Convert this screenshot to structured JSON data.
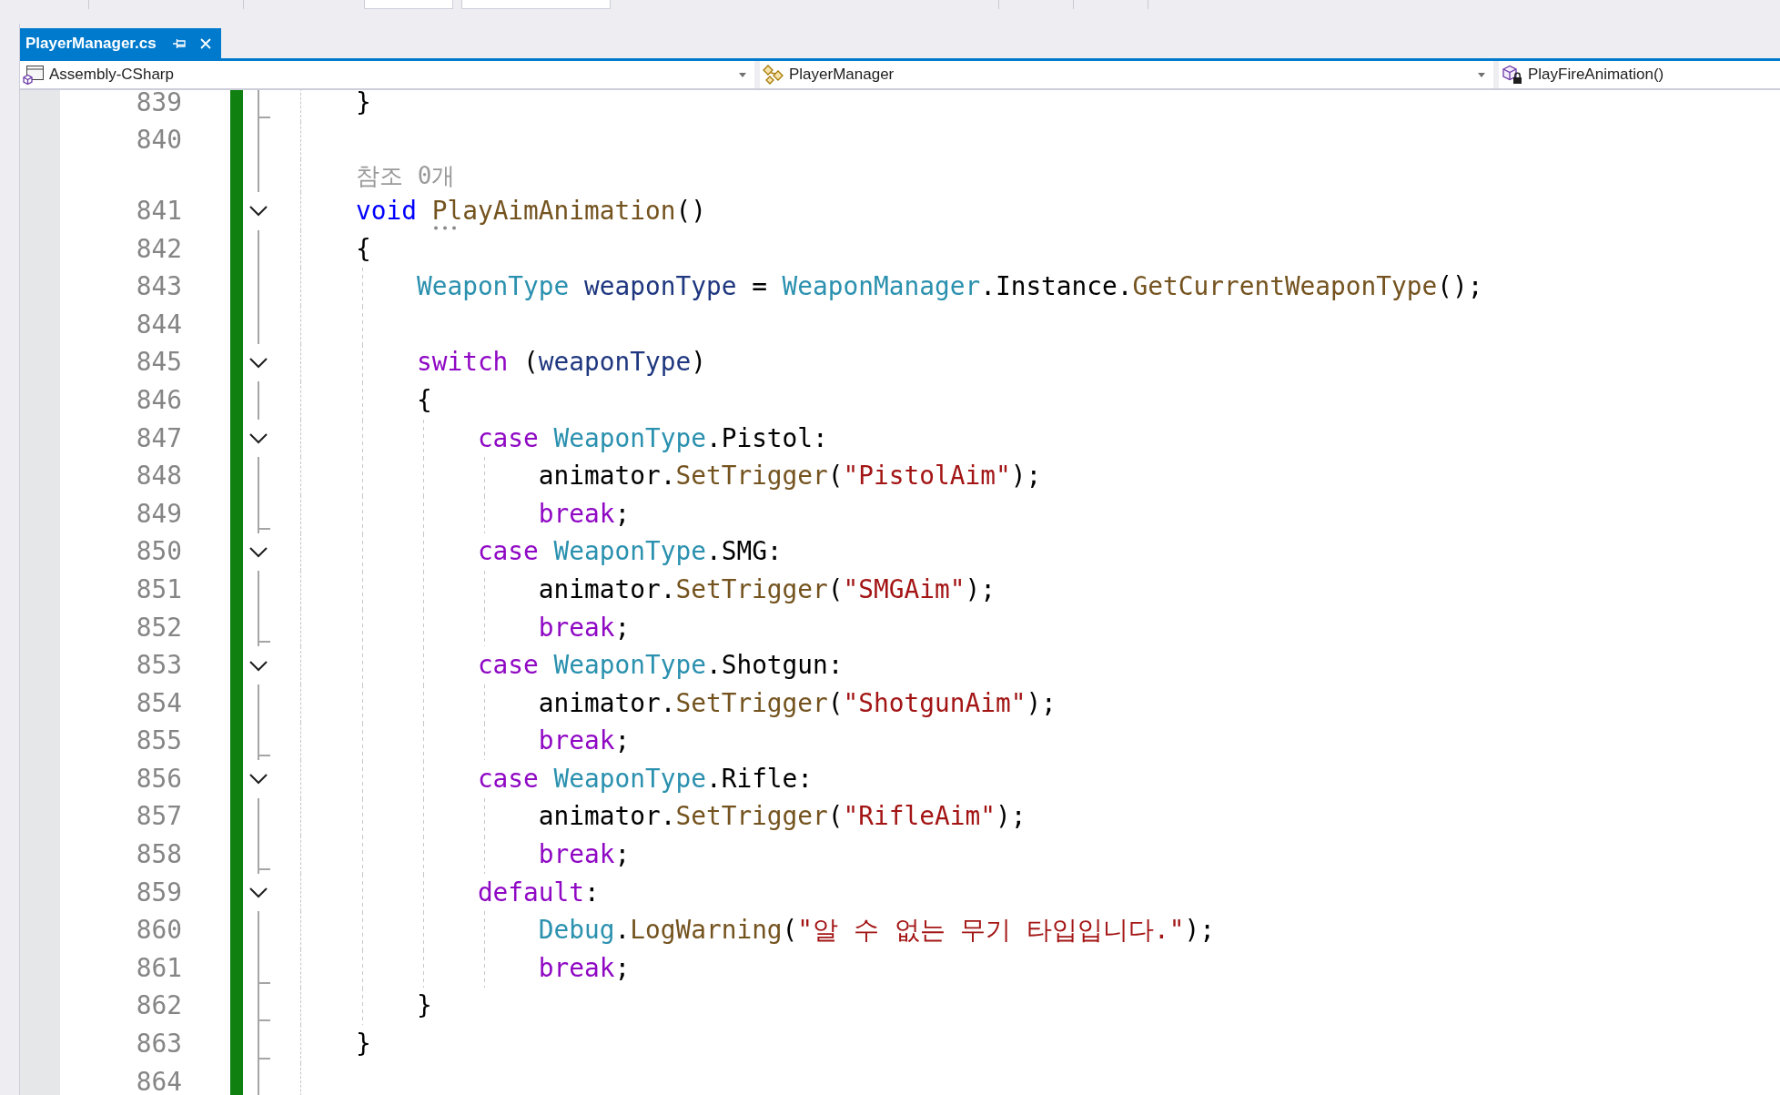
{
  "tabs": [
    {
      "label": "PlayerManager.cs",
      "selected": true,
      "pinned": false
    }
  ],
  "navigation_bar": [
    {
      "kind": "project",
      "text": "Assembly-CSharp",
      "caret": true
    },
    {
      "kind": "class",
      "text": "PlayerManager",
      "caret": true
    },
    {
      "kind": "method",
      "text": "PlayFireAnimation()",
      "caret": false
    }
  ],
  "editor": {
    "lines": [
      {
        "number": "839",
        "collapsible": false,
        "block_end": true,
        "changed": true,
        "tokens": [
          {
            "kind": "plain",
            "text": "}"
          }
        ]
      },
      {
        "number": "840",
        "collapsible": false,
        "block_end": false,
        "changed": true
      },
      {
        "number": "841",
        "codelens": "참조 0개",
        "collapsible": true,
        "block_end": false,
        "changed": true,
        "tokens": [
          {
            "kind": "keyword",
            "text": "void"
          },
          {
            "kind": "method",
            "text": " PlayAimAnimation",
            "suggestion": true
          },
          {
            "kind": "plain",
            "text": "()"
          }
        ]
      },
      {
        "number": "842",
        "collapsible": false,
        "block_end": false,
        "changed": true,
        "tokens": [
          {
            "kind": "plain",
            "text": "{"
          }
        ],
        "children": [
          {
            "number": "843",
            "collapsible": false,
            "block_end": false,
            "changed": true,
            "tokens": [
              {
                "kind": "type",
                "text": "WeaponType"
              },
              {
                "kind": "variable",
                "text": " weaponType"
              },
              {
                "kind": "plain",
                "text": " = "
              },
              {
                "kind": "type",
                "text": "WeaponManager"
              },
              {
                "kind": "plain",
                "text": ".Instance."
              },
              {
                "kind": "method",
                "text": "GetCurrentWeaponType"
              },
              {
                "kind": "plain",
                "text": "();"
              }
            ]
          },
          {
            "number": "844",
            "collapsible": false,
            "block_end": false,
            "changed": true
          },
          {
            "number": "845",
            "collapsible": true,
            "block_end": false,
            "changed": true,
            "tokens": [
              {
                "kind": "control",
                "text": "switch"
              },
              {
                "kind": "plain",
                "text": " ("
              },
              {
                "kind": "variable",
                "text": "weaponType"
              },
              {
                "kind": "plain",
                "text": ")"
              }
            ]
          },
          {
            "number": "846",
            "collapsible": false,
            "block_end": false,
            "changed": true,
            "tokens": [
              {
                "kind": "plain",
                "text": "{"
              }
            ],
            "children": [
              {
                "number": "847",
                "collapsible": true,
                "block_end": false,
                "changed": true,
                "tokens": [
                  {
                    "kind": "control",
                    "text": "case"
                  },
                  {
                    "kind": "type",
                    "text": " WeaponType"
                  },
                  {
                    "kind": "plain",
                    "text": ".Pistol:"
                  }
                ],
                "children": [
                  {
                    "number": "848",
                    "collapsible": false,
                    "block_end": false,
                    "changed": true,
                    "tokens": [
                      {
                        "kind": "plain",
                        "text": "animator."
                      },
                      {
                        "kind": "method",
                        "text": "SetTrigger"
                      },
                      {
                        "kind": "plain",
                        "text": "("
                      },
                      {
                        "kind": "string",
                        "text": "\"PistolAim\""
                      },
                      {
                        "kind": "plain",
                        "text": ");"
                      }
                    ]
                  },
                  {
                    "number": "849",
                    "collapsible": false,
                    "block_end": true,
                    "changed": true,
                    "tokens": [
                      {
                        "kind": "control",
                        "text": "break"
                      },
                      {
                        "kind": "plain",
                        "text": ";"
                      }
                    ]
                  }
                ]
              },
              {
                "number": "850",
                "collapsible": true,
                "block_end": false,
                "changed": true,
                "tokens": [
                  {
                    "kind": "control",
                    "text": "case"
                  },
                  {
                    "kind": "type",
                    "text": " WeaponType"
                  },
                  {
                    "kind": "plain",
                    "text": ".SMG:"
                  }
                ],
                "children": [
                  {
                    "number": "851",
                    "collapsible": false,
                    "block_end": false,
                    "changed": true,
                    "tokens": [
                      {
                        "kind": "plain",
                        "text": "animator."
                      },
                      {
                        "kind": "method",
                        "text": "SetTrigger"
                      },
                      {
                        "kind": "plain",
                        "text": "("
                      },
                      {
                        "kind": "string",
                        "text": "\"SMGAim\""
                      },
                      {
                        "kind": "plain",
                        "text": ");"
                      }
                    ]
                  },
                  {
                    "number": "852",
                    "collapsible": false,
                    "block_end": true,
                    "changed": true,
                    "tokens": [
                      {
                        "kind": "control",
                        "text": "break"
                      },
                      {
                        "kind": "plain",
                        "text": ";"
                      }
                    ]
                  }
                ]
              },
              {
                "number": "853",
                "collapsible": true,
                "block_end": false,
                "changed": true,
                "tokens": [
                  {
                    "kind": "control",
                    "text": "case"
                  },
                  {
                    "kind": "type",
                    "text": " WeaponType"
                  },
                  {
                    "kind": "plain",
                    "text": ".Shotgun:"
                  }
                ],
                "children": [
                  {
                    "number": "854",
                    "collapsible": false,
                    "block_end": false,
                    "changed": true,
                    "tokens": [
                      {
                        "kind": "plain",
                        "text": "animator."
                      },
                      {
                        "kind": "method",
                        "text": "SetTrigger"
                      },
                      {
                        "kind": "plain",
                        "text": "("
                      },
                      {
                        "kind": "string",
                        "text": "\"ShotgunAim\""
                      },
                      {
                        "kind": "plain",
                        "text": ");"
                      }
                    ]
                  },
                  {
                    "number": "855",
                    "collapsible": false,
                    "block_end": true,
                    "changed": true,
                    "tokens": [
                      {
                        "kind": "control",
                        "text": "break"
                      },
                      {
                        "kind": "plain",
                        "text": ";"
                      }
                    ]
                  }
                ]
              },
              {
                "number": "856",
                "collapsible": true,
                "block_end": false,
                "changed": true,
                "tokens": [
                  {
                    "kind": "control",
                    "text": "case"
                  },
                  {
                    "kind": "type",
                    "text": " WeaponType"
                  },
                  {
                    "kind": "plain",
                    "text": ".Rifle:"
                  }
                ],
                "children": [
                  {
                    "number": "857",
                    "collapsible": false,
                    "block_end": false,
                    "changed": true,
                    "tokens": [
                      {
                        "kind": "plain",
                        "text": "animator."
                      },
                      {
                        "kind": "method",
                        "text": "SetTrigger"
                      },
                      {
                        "kind": "plain",
                        "text": "("
                      },
                      {
                        "kind": "string",
                        "text": "\"RifleAim\""
                      },
                      {
                        "kind": "plain",
                        "text": ");"
                      }
                    ]
                  },
                  {
                    "number": "858",
                    "collapsible": false,
                    "block_end": true,
                    "changed": true,
                    "tokens": [
                      {
                        "kind": "control",
                        "text": "break"
                      },
                      {
                        "kind": "plain",
                        "text": ";"
                      }
                    ]
                  }
                ]
              },
              {
                "number": "859",
                "collapsible": true,
                "block_end": false,
                "changed": true,
                "tokens": [
                  {
                    "kind": "control",
                    "text": "default"
                  },
                  {
                    "kind": "plain",
                    "text": ":"
                  }
                ],
                "children": [
                  {
                    "number": "860",
                    "collapsible": false,
                    "block_end": false,
                    "changed": true,
                    "tokens": [
                      {
                        "kind": "type",
                        "text": "Debug"
                      },
                      {
                        "kind": "plain",
                        "text": "."
                      },
                      {
                        "kind": "method",
                        "text": "LogWarning"
                      },
                      {
                        "kind": "plain",
                        "text": "("
                      },
                      {
                        "kind": "string",
                        "text": "\"알 수 없는 무기 타입입니다.\""
                      },
                      {
                        "kind": "plain",
                        "text": ");"
                      }
                    ]
                  },
                  {
                    "number": "861",
                    "collapsible": false,
                    "block_end": true,
                    "changed": true,
                    "tokens": [
                      {
                        "kind": "control",
                        "text": "break"
                      },
                      {
                        "kind": "plain",
                        "text": ";"
                      }
                    ]
                  }
                ]
              }
            ]
          },
          {
            "number": "862",
            "collapsible": false,
            "block_end": true,
            "changed": true,
            "tokens": [
              {
                "kind": "plain",
                "text": "}"
              }
            ]
          }
        ]
      },
      {
        "number": "863",
        "collapsible": false,
        "block_end": true,
        "changed": true,
        "tokens": [
          {
            "kind": "plain",
            "text": "}"
          }
        ]
      },
      {
        "number": "864",
        "collapsible": false,
        "block_end": false,
        "changed": true
      }
    ]
  }
}
